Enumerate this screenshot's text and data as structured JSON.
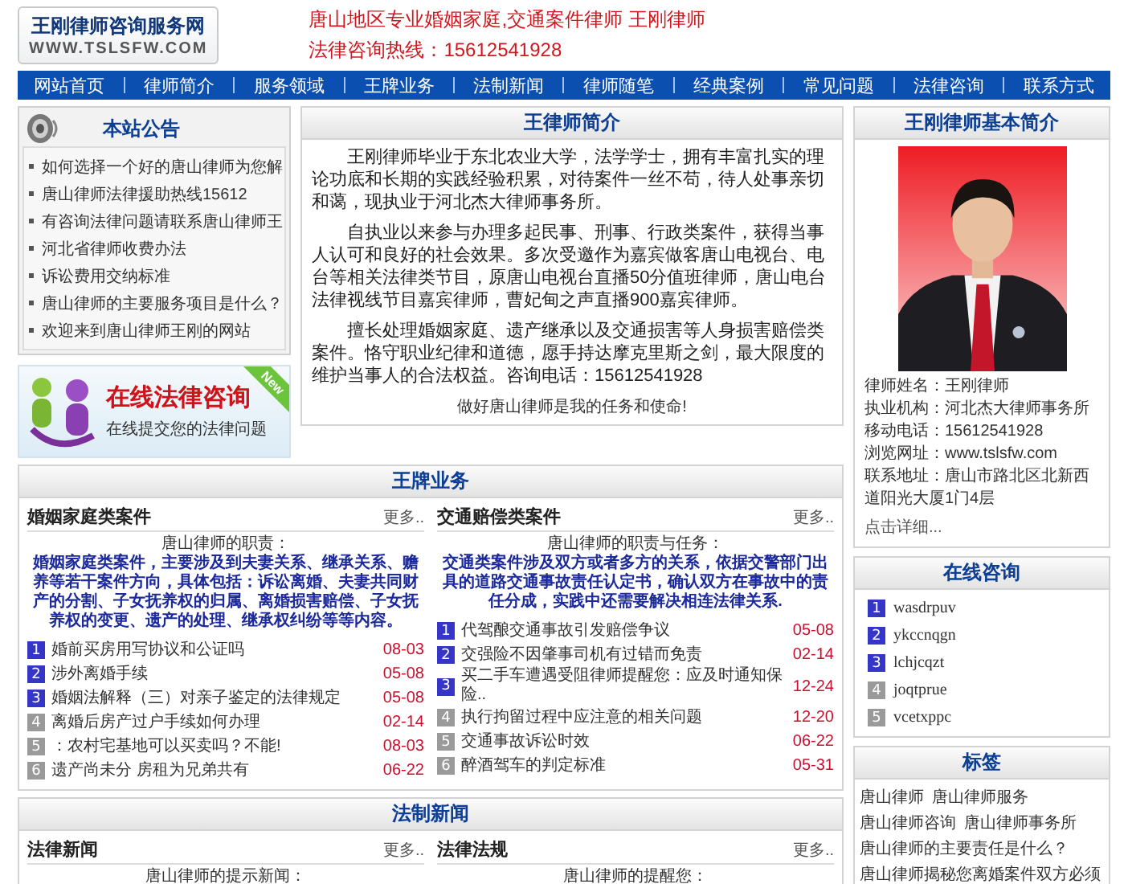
{
  "site": {
    "logo_title": "王刚律师咨询服务网",
    "logo_url": "WWW.TSLSFW.COM",
    "tagline": "唐山地区专业婚姻家庭,交通案件律师 王刚律师",
    "hotline": "法律咨询热线：15612541928"
  },
  "nav": [
    "网站首页",
    "律师简介",
    "服务领域",
    "王牌业务",
    "法制新闻",
    "律师随笔",
    "经典案例",
    "常见问题",
    "法律咨询",
    "联系方式"
  ],
  "notice": {
    "title": "本站公告",
    "items": [
      "如何选择一个好的唐山律师为您解",
      "唐山律师法律援助热线15612",
      "有咨询法律问题请联系唐山律师王",
      "河北省律师收费办法",
      "诉讼费用交纳标准",
      "唐山律师的主要服务项目是什么？",
      "欢迎来到唐山律师王刚的网站"
    ]
  },
  "banner": {
    "title": "在线法律咨询",
    "subtitle": "在线提交您的法律问题",
    "badge": "New"
  },
  "intro": {
    "title": "王律师简介",
    "paragraphs": [
      "王刚律师毕业于东北农业大学，法学学士，拥有丰富扎实的理论功底和长期的实践经验积累，对待案件一丝不苟，待人处事亲切和蔼，现执业于河北杰大律师事务所。",
      "自执业以来参与办理多起民事、刑事、行政类案件，获得当事人认可和良好的社会效果。多次受邀作为嘉宾做客唐山电视台、电台等相关法律类节目，原唐山电视台直播50分值班律师，唐山电台法律视线节目嘉宾律师，曹妃甸之声直播900嘉宾律师。",
      "擅长处理婚姻家庭、遗产继承以及交通损害等人身损害赔偿类案件。恪守职业纪律和道德，愿手持达摩克里斯之剑，最大限度的维护当事人的合法权益。咨询电话：15612541928"
    ],
    "footer": "做好唐山律师是我的任务和使命!"
  },
  "featured": {
    "title": "王牌业务",
    "panels": [
      {
        "title": "婚姻家庭类案件",
        "more": "更多..",
        "lead": "唐山律师的职责：",
        "description": "婚姻家庭类案件，主要涉及到夫妻关系、继承关系、赡养等若干案件方向，具体包括：诉讼离婚、夫妻共同财产的分割、子女抚养权的归属、离婚损害赔偿、子女抚养权的变更、遗产的处理、继承权纠纷等等内容。",
        "items": [
          {
            "index": "1",
            "title": "婚前买房用写协议和公证吗",
            "date": "08-03",
            "highlighted": true
          },
          {
            "index": "2",
            "title": "涉外离婚手续",
            "date": "05-08",
            "highlighted": true
          },
          {
            "index": "3",
            "title": "婚姻法解释（三）对亲子鉴定的法律规定",
            "date": "05-08",
            "highlighted": true
          },
          {
            "index": "4",
            "title": "离婚后房产过户手续如何办理",
            "date": "02-14",
            "highlighted": false
          },
          {
            "index": "5",
            "title": "：农村宅基地可以买卖吗？不能!",
            "date": "08-03",
            "highlighted": false
          },
          {
            "index": "6",
            "title": "遗产尚未分 房租为兄弟共有",
            "date": "06-22",
            "highlighted": false
          }
        ]
      },
      {
        "title": "交通赔偿类案件",
        "more": "更多..",
        "lead": "唐山律师的职责与任务：",
        "description": "交通类案件涉及双方或者多方的关系，依据交警部门出具的道路交通事故责任认定书，确认双方在事故中的责任分成，实践中还需要解决相连法律关系.",
        "items": [
          {
            "index": "1",
            "title": "代驾酿交通事故引发赔偿争议",
            "date": "05-08",
            "highlighted": true
          },
          {
            "index": "2",
            "title": "交强险不因肇事司机有过错而免责",
            "date": "02-14",
            "highlighted": true
          },
          {
            "index": "3",
            "title": "买二手车遭遇受阻律师提醒您：应及时通知保险..",
            "date": "12-24",
            "highlighted": true
          },
          {
            "index": "4",
            "title": "执行拘留过程中应注意的相关问题",
            "date": "12-20",
            "highlighted": false
          },
          {
            "index": "5",
            "title": "交通事故诉讼时效",
            "date": "06-22",
            "highlighted": false
          },
          {
            "index": "6",
            "title": "醉酒驾车的判定标准",
            "date": "05-31",
            "highlighted": false
          }
        ]
      }
    ]
  },
  "news": {
    "title": "法制新闻",
    "panels": [
      {
        "title": "法律新闻",
        "more": "更多..",
        "lead": "唐山律师的提示新闻："
      },
      {
        "title": "法律法规",
        "more": "更多..",
        "lead": "唐山律师的提醒您："
      }
    ]
  },
  "profile": {
    "title": "王刚律师基本简介",
    "photo": {
      "kind": "picture"
    },
    "lines": [
      "律师姓名：王刚律师",
      "执业机构：河北杰大律师事务所",
      "移动电话：15612541928",
      "浏览网址：www.tslsfw.com",
      "联系地址：唐山市路北区北新西道阳光大厦1门4层"
    ],
    "more": "点击详细..."
  },
  "online": {
    "title": "在线咨询",
    "items": [
      {
        "index": "1",
        "name": "wasdrpuv",
        "highlighted": true
      },
      {
        "index": "2",
        "name": "ykccnqgn",
        "highlighted": true
      },
      {
        "index": "3",
        "name": "lchjcqzt",
        "highlighted": true
      },
      {
        "index": "4",
        "name": "joqtprue",
        "highlighted": false
      },
      {
        "index": "5",
        "name": "vcetxppc",
        "highlighted": false
      }
    ]
  },
  "tags": {
    "title": "标签",
    "items": [
      "唐山律师",
      "唐山律师服务",
      "唐山律师咨询",
      "唐山律师事务所",
      "唐山律师的主要责任是什么？",
      "唐山律师揭秘您离婚案件双方必须"
    ]
  }
}
